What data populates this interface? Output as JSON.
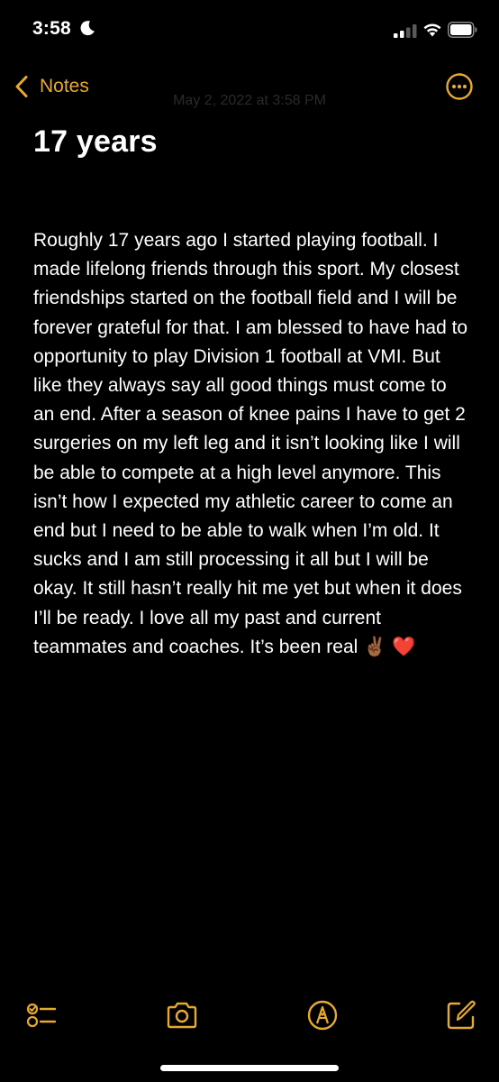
{
  "status_bar": {
    "time": "3:58"
  },
  "nav": {
    "back_label": "Notes"
  },
  "note": {
    "date": "May 2, 2022 at 3:58 PM",
    "title": "17 years",
    "body": "Roughly 17 years ago I started playing football. I made lifelong friends through this sport. My closest friendships started on the football field and I will be forever grateful for that. I am blessed to have had to opportunity to play Division 1 football at VMI. But like they always say all good things must come to an end. After a season of knee pains I have to get 2 surgeries on my left leg and it isn’t looking like I will be able to compete at a high level anymore. This isn’t how I expected my athletic career to come an end but I need to be able to walk when I’m old. It sucks and I am still processing it all but I will be okay. It still hasn’t really hit me yet but when it does I’ll be ready. I love all my past and current teammates and coaches. It’s been real ✌🏾 ❤️"
  },
  "colors": {
    "accent": "#e7aa2e",
    "background": "#000000",
    "text": "#ffffff"
  },
  "icons": {
    "back": "chevron-left-icon",
    "more": "ellipsis-circle-icon",
    "checklist": "checklist-icon",
    "camera": "camera-icon",
    "markup": "pen-tip-circle-icon",
    "compose": "compose-icon"
  }
}
